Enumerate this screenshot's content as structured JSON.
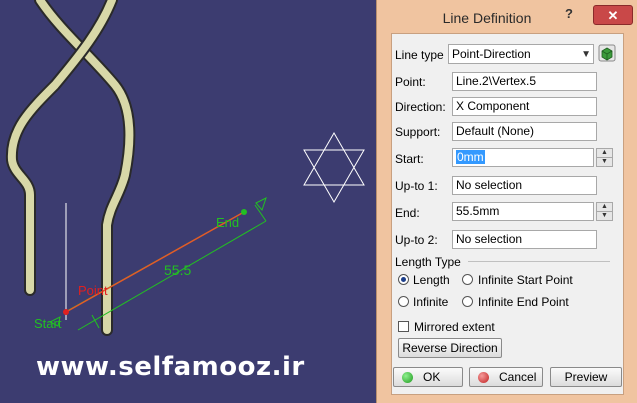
{
  "viewport": {
    "watermark": "www.selfamooz.ir",
    "labels": {
      "end": "End",
      "point": "Point",
      "start": "Start",
      "length": "55.5"
    }
  },
  "dialog": {
    "title": "Line Definition",
    "help": "?",
    "close": "✕",
    "line_type_label": "Line type :",
    "line_type_value": "Point-Direction",
    "point_label": "Point:",
    "point_value": "Line.2\\Vertex.5",
    "direction_label": "Direction:",
    "direction_value": "X Component",
    "support_label": "Support:",
    "support_value": "Default (None)",
    "start_label": "Start:",
    "start_value": "0mm",
    "upto1_label": "Up-to 1:",
    "upto1_value": "No selection",
    "end_label": "End:",
    "end_value": "55.5mm",
    "upto2_label": "Up-to 2:",
    "upto2_value": "No selection",
    "length_type_group": "Length Type",
    "radio_length": "Length",
    "radio_infinite_start": "Infinite Start Point",
    "radio_infinite": "Infinite",
    "radio_infinite_end": "Infinite End Point",
    "mirrored_label": "Mirrored extent",
    "reverse_button": "Reverse Direction",
    "ok_button": "OK",
    "cancel_button": "Cancel",
    "preview_button": "Preview"
  },
  "colors": {
    "viewport_bg": "#3c3c70",
    "dialog_bg": "#f0c4a0",
    "tube_fill": "#d8d8a8",
    "preview_line": "#e35a28",
    "dimension": "#22c022",
    "point_label": "#e02020"
  }
}
